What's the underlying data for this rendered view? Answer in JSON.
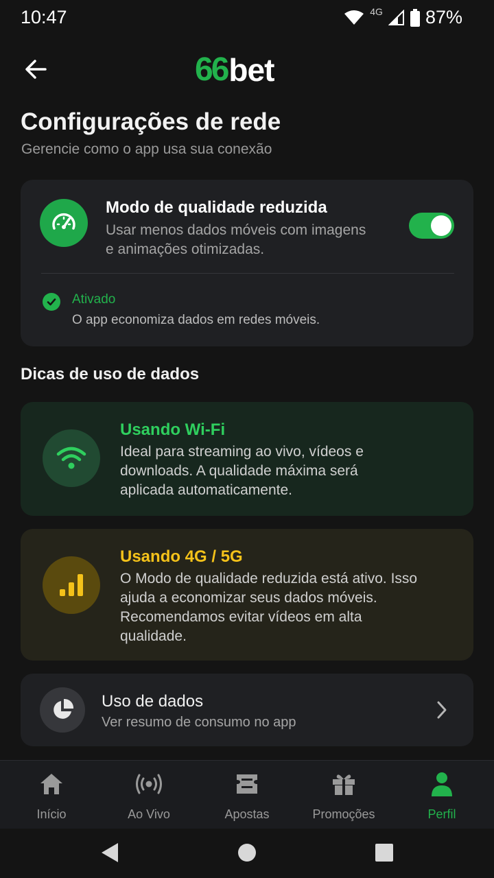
{
  "status_bar": {
    "time": "10:47",
    "network": "4G",
    "battery": "87%"
  },
  "header": {
    "back_icon": "arrow-left-icon",
    "logo_num": "66",
    "logo_text": "bet"
  },
  "page": {
    "title": "Configurações de rede",
    "subtitle": "Gerencie como o app usa sua conexão"
  },
  "quality_mode": {
    "icon": "speedometer-icon",
    "title": "Modo de qualidade reduzida",
    "description": "Usar menos dados móveis com imagens e animações otimizadas.",
    "enabled": true,
    "status_label": "Ativado",
    "status_description": "O app economiza dados em redes móveis."
  },
  "tips": {
    "section_title": "Dicas de uso de dados",
    "wifi": {
      "icon": "wifi-icon",
      "title": "Usando Wi-Fi",
      "description": "Ideal para streaming ao vivo, vídeos e downloads. A qualidade máxima será aplicada automaticamente."
    },
    "mobile": {
      "icon": "signal-bars-icon",
      "title": "Usando 4G / 5G",
      "description": "O Modo de qualidade reduzida está ativo. Isso ajuda a economizar seus dados móveis. Recomendamos evitar vídeos em alta qualidade."
    }
  },
  "data_usage": {
    "icon": "pie-chart-icon",
    "title": "Uso de dados",
    "subtitle": "Ver resumo de consumo no app"
  },
  "bottom_nav": {
    "items": [
      {
        "label": "Início",
        "icon": "home-icon"
      },
      {
        "label": "Ao Vivo",
        "icon": "live-broadcast-icon"
      },
      {
        "label": "Apostas",
        "icon": "ticket-icon"
      },
      {
        "label": "Promoções",
        "icon": "gift-icon"
      },
      {
        "label": "Perfil",
        "icon": "user-icon",
        "active": true
      }
    ]
  },
  "colors": {
    "accent": "#22b24c",
    "warning": "#f4c21a",
    "background": "#141414",
    "card": "#1f2023"
  }
}
